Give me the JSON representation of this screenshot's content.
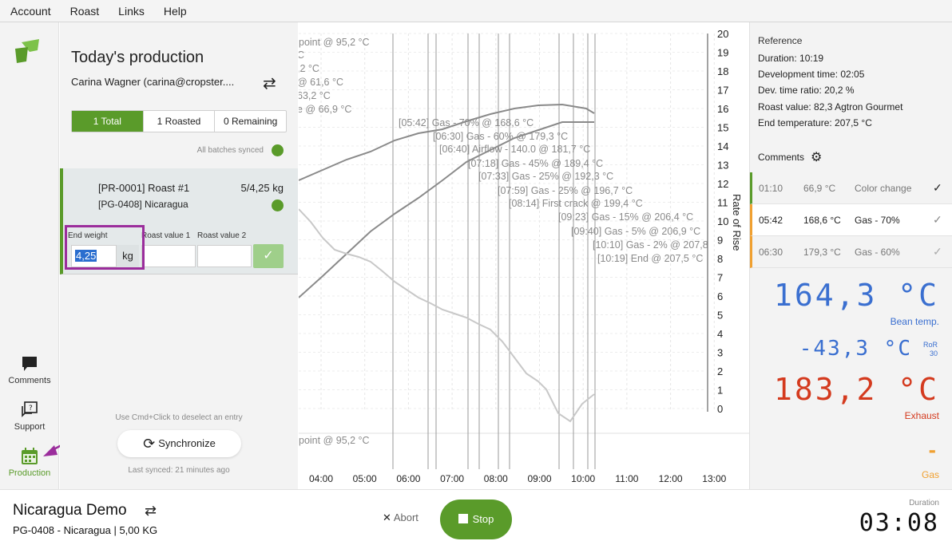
{
  "menu": [
    "Account",
    "Roast",
    "Links",
    "Help"
  ],
  "rail": {
    "comments_label": "Comments",
    "support_label": "Support",
    "production_label": "Production"
  },
  "production": {
    "title": "Today's production",
    "user": "Carina Wagner (carina@cropster....",
    "tabs": [
      "1 Total",
      "1 Roasted",
      "0 Remaining"
    ],
    "sync_status": "All batches synced",
    "batch": {
      "name": "[PR-0001] Roast #1",
      "qty": "5/4,25 kg",
      "green": "[PG-0408] Nicaragua",
      "end_weight_label": "End weight",
      "end_weight_value": "4,25",
      "unit": "kg",
      "roast_value1_label": "Roast value 1",
      "roast_value2_label": "Roast value 2"
    },
    "hint": "Use Cmd+Click to deselect an entry",
    "sync_button": "Synchronize",
    "last_synced": "Last synced: 21 minutes ago"
  },
  "chart": {
    "right_axis_label": "Rate of Rise",
    "right_ticks": [
      "20",
      "19",
      "18",
      "17",
      "16",
      "15",
      "14",
      "13",
      "12",
      "11",
      "10",
      "9",
      "8",
      "7",
      "6",
      "5",
      "4",
      "3",
      "2",
      "1",
      "0"
    ],
    "x_ticks": [
      "04:00",
      "05:00",
      "06:00",
      "07:00",
      "08:00",
      "09:00",
      "10:00",
      "11:00",
      "12:00",
      "13:00"
    ],
    "left_annotations": [
      "point @ 95,2 °C",
      "C",
      ",2 °C",
      "@ 61,6 °C",
      "63,2 °C",
      "e @ 66,9 °C"
    ],
    "bottom_annotation": "point @ 95,2 °C",
    "events": [
      "[05:42] Gas - 70% @ 168,6 °C",
      "[06:30] Gas - 60% @ 179,3 °C",
      "[06:40] Airflow - 140.0 @ 181,7 °C",
      "[07:18] Gas - 45% @ 189,4 °C",
      "[07:33] Gas - 25% @ 192,3 °C",
      "[07:59] Gas - 25% @ 196,7 °C",
      "[08:14] First crack @ 199,4 °C",
      "[09:23] Gas - 15% @ 206,4 °C",
      "[09:40] Gas - 5% @ 206,9 °C",
      "[10:10] Gas - 2% @ 207,8",
      "[10:19] End @ 207,5 °C"
    ]
  },
  "reference": {
    "title": "Reference",
    "lines": [
      "Duration: 10:19",
      "Development time: 02:05",
      "Dev. time ratio: 20,2 %",
      "Roast value: 82,3 Agtron Gourmet",
      "End temperature: 207,5 °C"
    ],
    "comments_title": "Comments",
    "comments": [
      {
        "time": "01:10",
        "temp": "66,9 °C",
        "text": "Color change",
        "color": "#5a9b2a"
      },
      {
        "time": "05:42",
        "temp": "168,6 °C",
        "text": "Gas - 70%",
        "color": "#f0a030"
      },
      {
        "time": "06:30",
        "temp": "179,3 °C",
        "text": "Gas - 60%",
        "color": "#f0a030"
      }
    ]
  },
  "readouts": {
    "bean_temp": "164,3 °C",
    "bean_label": "Bean temp.",
    "ror": "-43,3 °C",
    "ror_label": "RoR",
    "ror_sub": "30",
    "exhaust": "183,2 °C",
    "exhaust_label": "Exhaust",
    "gas": "-",
    "gas_label": "Gas",
    "colors": {
      "bean": "#3a6fd0",
      "exhaust": "#d43a1e",
      "gas": "#f0a030"
    }
  },
  "bottom": {
    "title": "Nicaragua Demo",
    "subtitle": "PG-0408 - Nicaragua | 5,00 KG",
    "abort": "Abort",
    "stop": "Stop",
    "duration_label": "Duration",
    "duration": "03:08"
  }
}
